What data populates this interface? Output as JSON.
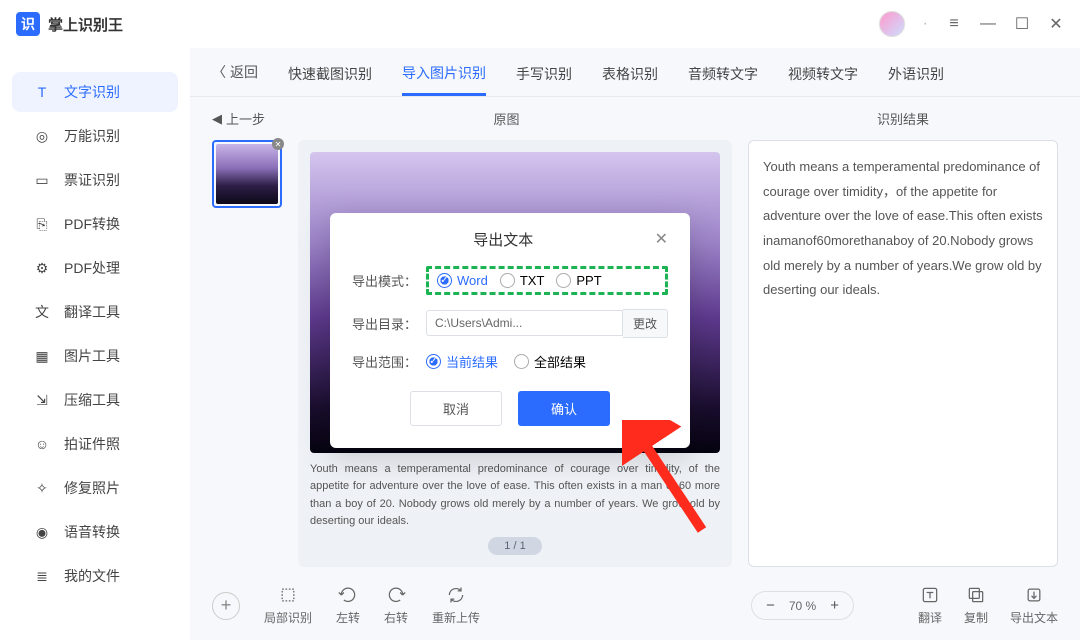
{
  "app": {
    "title": "掌上识别王"
  },
  "sidebar": {
    "items": [
      {
        "label": "文字识别"
      },
      {
        "label": "万能识别"
      },
      {
        "label": "票证识别"
      },
      {
        "label": "PDF转换"
      },
      {
        "label": "PDF处理"
      },
      {
        "label": "翻译工具"
      },
      {
        "label": "图片工具"
      },
      {
        "label": "压缩工具"
      },
      {
        "label": "拍证件照"
      },
      {
        "label": "修复照片"
      },
      {
        "label": "语音转换"
      },
      {
        "label": "我的文件"
      }
    ]
  },
  "tabs": {
    "back": "返回",
    "items": [
      {
        "label": "快速截图识别"
      },
      {
        "label": "导入图片识别"
      },
      {
        "label": "手写识别"
      },
      {
        "label": "表格识别"
      },
      {
        "label": "音频转文字"
      },
      {
        "label": "视频转文字"
      },
      {
        "label": "外语识别"
      }
    ]
  },
  "subheader": {
    "prev": "上一步",
    "original": "原图",
    "result": "识别结果"
  },
  "preview": {
    "caption": "Youth means a temperamental predominance of courage over timidity, of the appetite for adventure over the love of ease. This often exists in a man of 60 more than a boy of 20. Nobody grows old merely by a number of years. We grow old by deserting our ideals.",
    "pager": "1 / 1"
  },
  "result": {
    "text": "Youth means a temperamental predominance of courage over timidity，of the appetite for adventure over the love of ease.This often exists inamanof60morethanaboy of 20.Nobody grows old merely by a number of years.We grow old by deserting our ideals."
  },
  "toolbar": {
    "tools": [
      {
        "label": "局部识别"
      },
      {
        "label": "左转"
      },
      {
        "label": "右转"
      },
      {
        "label": "重新上传"
      }
    ],
    "zoom": "70 %",
    "right": [
      {
        "label": "翻译"
      },
      {
        "label": "复制"
      },
      {
        "label": "导出文本"
      }
    ]
  },
  "modal": {
    "title": "导出文本",
    "mode_label": "导出模式：",
    "modes": [
      {
        "label": "Word",
        "selected": true
      },
      {
        "label": "TXT",
        "selected": false
      },
      {
        "label": "PPT",
        "selected": false
      }
    ],
    "dir_label": "导出目录：",
    "dir_value": "C:\\Users\\Admi...",
    "dir_change": "更改",
    "scope_label": "导出范围：",
    "scopes": [
      {
        "label": "当前结果",
        "selected": true
      },
      {
        "label": "全部结果",
        "selected": false
      }
    ],
    "cancel": "取消",
    "confirm": "确认"
  }
}
